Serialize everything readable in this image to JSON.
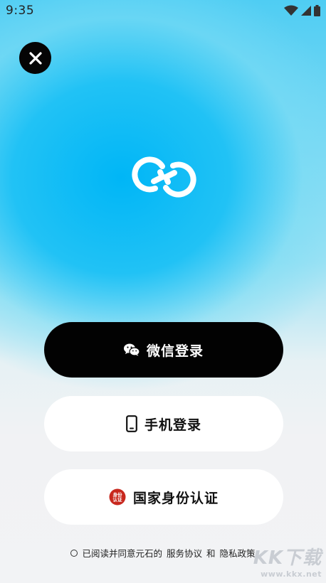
{
  "status_bar": {
    "time": "9:35"
  },
  "buttons": {
    "wechat_label": "微信登录",
    "phone_label": "手机登录",
    "id_label": "国家身份认证",
    "id_badge_text": "身份认证"
  },
  "agreement": {
    "prefix": "已阅读并同意元石的",
    "service_link": "服务协议",
    "conjunction": "和",
    "privacy_link": "隐私政策"
  },
  "watermark": {
    "main": "KK下载",
    "url": "www.kkx.net"
  },
  "colors": {
    "primary_black": "#020202",
    "sky_blue": "#00b6f6",
    "id_badge_red": "#c8281e"
  }
}
